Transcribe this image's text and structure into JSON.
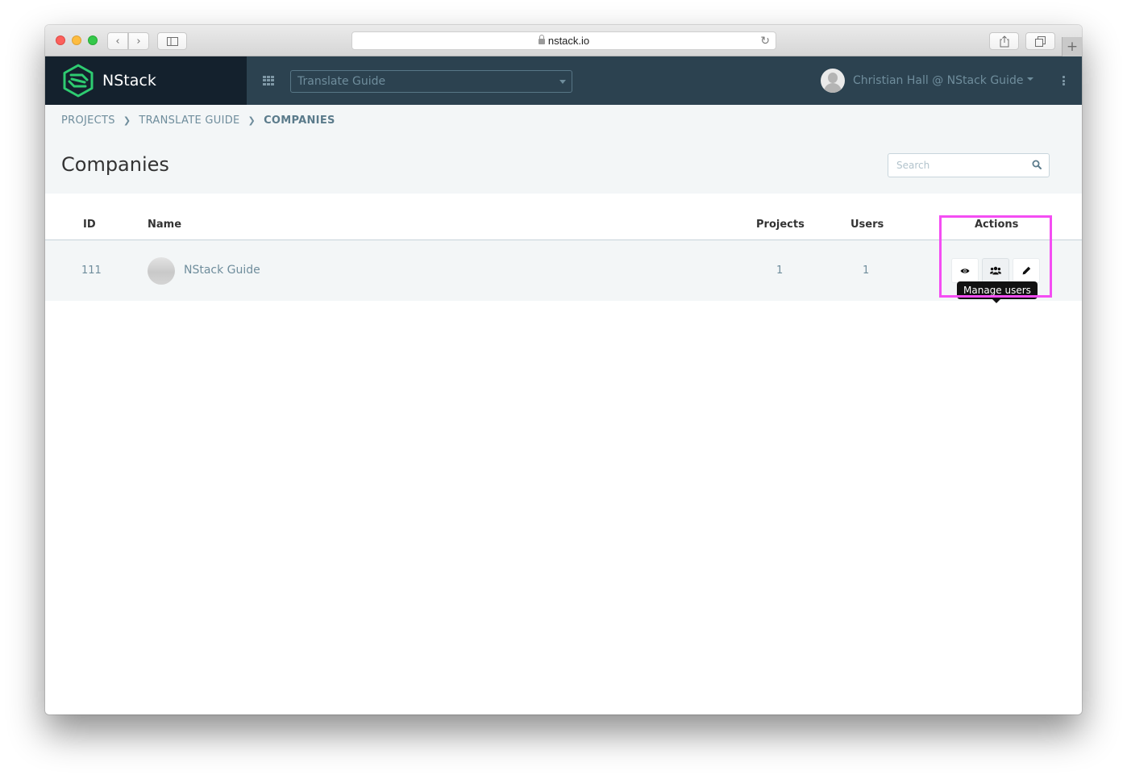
{
  "browser": {
    "url": "nstack.io"
  },
  "app": {
    "brand_name": "NStack",
    "project_selector": "Translate Guide",
    "user_menu": "Christian Hall @ NStack Guide"
  },
  "breadcrumb": {
    "items": [
      "PROJECTS",
      "TRANSLATE GUIDE",
      "COMPANIES"
    ],
    "separator": "❯"
  },
  "page": {
    "title": "Companies",
    "search_placeholder": "Search"
  },
  "table": {
    "headers": {
      "id": "ID",
      "name": "Name",
      "projects": "Projects",
      "users": "Users",
      "actions": "Actions"
    },
    "rows": [
      {
        "id": "111",
        "name": "NStack Guide",
        "projects": "1",
        "users": "1"
      }
    ],
    "action_icons": [
      "eye-icon",
      "users-icon",
      "pencil-icon"
    ],
    "tooltip": "Manage users"
  },
  "colors": {
    "brand_green": "#2ecc71",
    "header_dark": "#14212d",
    "header": "#2c4250",
    "muted_text": "#6f8d9c",
    "highlight": "#f44df3"
  }
}
